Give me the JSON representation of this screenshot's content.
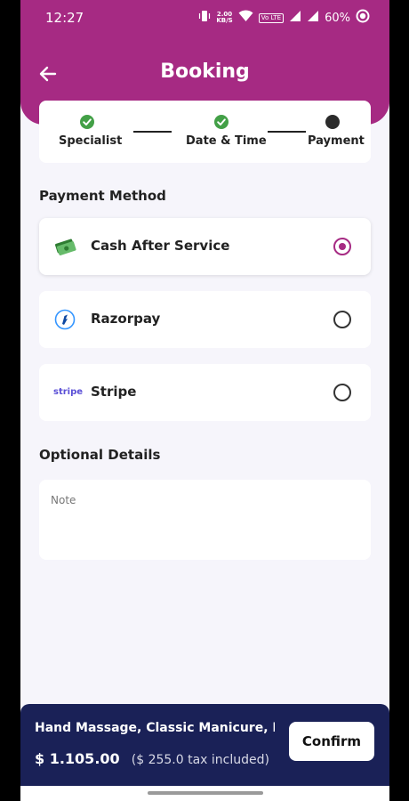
{
  "status_bar": {
    "time": "12:27",
    "net_speed_value": "2.00",
    "net_speed_unit": "KB/S",
    "volte": "Vo LTE",
    "battery": "60%",
    "icons": [
      "vibrate-icon",
      "wifi-icon",
      "signal-icon",
      "signal-icon",
      "battery-ring-icon"
    ]
  },
  "header": {
    "title": "Booking",
    "back_icon": "arrow-left-icon",
    "color": "#a62a83"
  },
  "stepper": {
    "steps": [
      {
        "label": "Specialist",
        "state": "done",
        "color": "#43a047"
      },
      {
        "label": "Date & Time",
        "state": "done",
        "color": "#43a047"
      },
      {
        "label": "Payment",
        "state": "current",
        "color": "#2b2b2b"
      }
    ]
  },
  "payment": {
    "section_title": "Payment Method",
    "selected": "cash",
    "methods": [
      {
        "id": "cash",
        "label": "Cash After Service",
        "icon": "cash-icon",
        "selected": true
      },
      {
        "id": "razorpay",
        "label": "Razorpay",
        "icon": "razorpay-icon",
        "selected": false
      },
      {
        "id": "stripe",
        "label": "Stripe",
        "icon": "stripe-logo",
        "icon_text": "stripe",
        "selected": false
      }
    ],
    "accent": "#a62a83"
  },
  "optional": {
    "section_title": "Optional Details",
    "note_placeholder": "Note",
    "note_value": ""
  },
  "summary": {
    "services": "Hand Massage, Classic Manicure, Pe",
    "price": "$ 1.105.00",
    "tax_note": "($ 255.0 tax included)",
    "confirm_label": "Confirm",
    "background": "#1a2157"
  }
}
